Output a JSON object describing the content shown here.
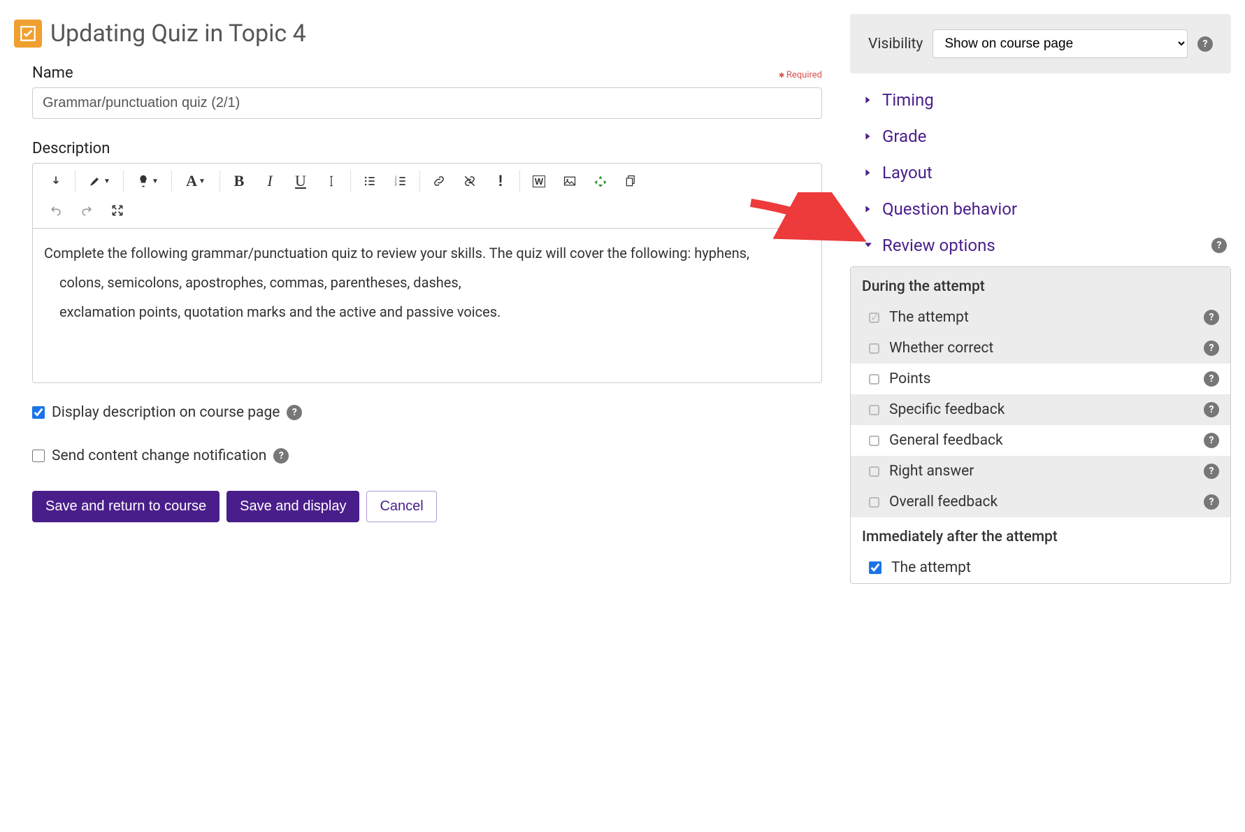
{
  "page": {
    "title": "Updating Quiz in Topic 4"
  },
  "form": {
    "name_label": "Name",
    "required_label": "Required",
    "name_value": "Grammar/punctuation quiz (2/1)",
    "description_label": "Description",
    "description_paragraphs": {
      "p1": "Complete the following grammar/punctuation quiz to review your skills. The quiz will cover the following: hyphens,",
      "p2": "colons, semicolons, apostrophes, commas, parentheses, dashes,",
      "p3": "exclamation points, quotation marks and the active and passive voices."
    },
    "display_desc_label": "Display description on course page",
    "send_notification_label": "Send content change notification",
    "save_return_label": "Save and return to course",
    "save_display_label": "Save and display",
    "cancel_label": "Cancel"
  },
  "sidebar": {
    "visibility_label": "Visibility",
    "visibility_value": "Show on course page",
    "sections": {
      "timing": "Timing",
      "grade": "Grade",
      "layout": "Layout",
      "question_behavior": "Question behavior",
      "review_options": "Review options"
    },
    "review": {
      "during_title": "During the attempt",
      "immediately_title": "Immediately after the attempt",
      "items": {
        "attempt": "The attempt",
        "whether_correct": "Whether correct",
        "points": "Points",
        "specific_feedback": "Specific feedback",
        "general_feedback": "General feedback",
        "right_answer": "Right answer",
        "overall_feedback": "Overall feedback"
      }
    }
  }
}
